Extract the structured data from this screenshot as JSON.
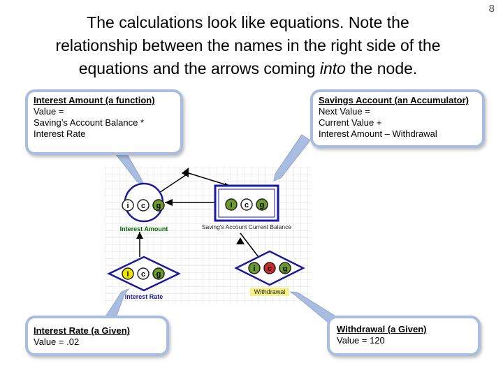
{
  "slide_number": "8",
  "heading": {
    "line1": "The calculations look like equations.  Note the",
    "line2": "relationship between the names in the right side of the",
    "line3_pre": "equations and the arrows coming ",
    "line3_em": "into",
    "line3_post": " the node."
  },
  "callouts": {
    "interest_amount": {
      "title": "Interest Amount (a function)",
      "lines": [
        "Value =",
        "Saving’s Account Balance *",
        "Interest Rate"
      ]
    },
    "savings_account": {
      "title": "Savings Account (an Accumulator)",
      "lines": [
        "Next Value =",
        "Current Value +",
        "Interest Amount – Withdrawal"
      ]
    },
    "interest_rate": {
      "title": "Interest Rate (a Given)",
      "lines": [
        "Value = .02"
      ]
    },
    "withdrawal": {
      "title": "Withdrawal (a Given)",
      "lines": [
        "Value = 120"
      ]
    }
  },
  "diagram": {
    "node_labels": {
      "interest_amount": "Interest Amount",
      "savings_account": "Saving's Account Current Balance",
      "interest_rate": "Interest Rate",
      "withdrawal": "Withdrawal"
    },
    "badges": {
      "i": "i",
      "c": "c",
      "g": "g"
    },
    "colors": {
      "node_border": "#1a1aa0",
      "callout_border": "#a9bde0",
      "badge_green": "#6a9a2a",
      "badge_yellow": "#f2e600",
      "badge_red": "#cc2a2a",
      "label_green": "#006600",
      "label_blue": "#1a1aa0",
      "label_withdrawal_bg": "#f4f08c"
    }
  }
}
